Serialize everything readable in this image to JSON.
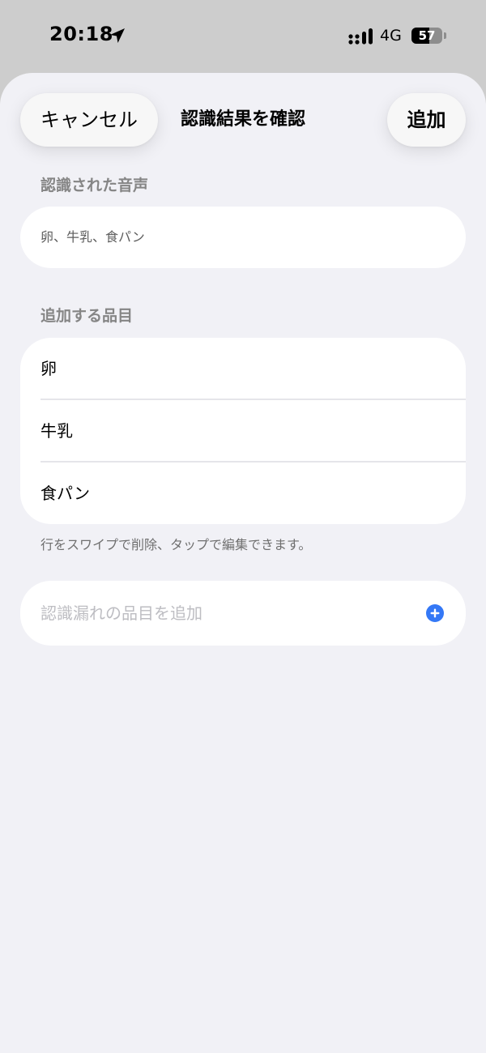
{
  "status_bar": {
    "time": "20:18",
    "network": "4G",
    "battery": "57",
    "battery_fraction": 0.57,
    "icons": [
      "location-arrow-icon",
      "signal-icon",
      "battery-icon"
    ]
  },
  "sheet": {
    "title": "認識結果を確認",
    "cancel_label": "キャンセル",
    "add_label": "追加"
  },
  "voice_section": {
    "header": "認識された音声",
    "text": "卵、牛乳、食パン"
  },
  "items_section": {
    "header": "追加する品目",
    "items": [
      {
        "label": "卵"
      },
      {
        "label": "牛乳"
      },
      {
        "label": "食パン"
      }
    ],
    "hint": "行をスワイプで削除、タップで編集できます。"
  },
  "add_item": {
    "placeholder": "認識漏れの品目を追加",
    "icon": "plus-circle-icon"
  },
  "colors": {
    "accent": "#3478f6",
    "sheet_background": "#f1f1f6",
    "card_background": "#ffffff",
    "status_bar_background": "#cdcdcd"
  }
}
